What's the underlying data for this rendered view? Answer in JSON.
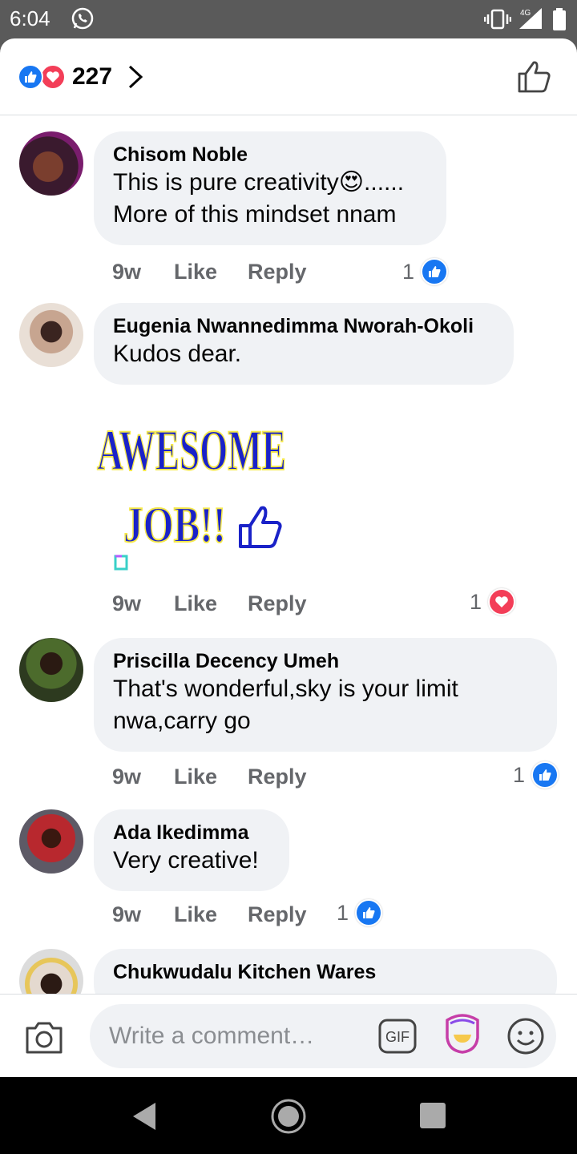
{
  "status_bar": {
    "time": "6:04",
    "network": "4G"
  },
  "header": {
    "reaction_count": "227"
  },
  "comments": [
    {
      "author": "Chisom Noble",
      "lines": [
        "This is pure creativity😍......",
        "More of this mindset nnam"
      ],
      "time": "9w",
      "like_label": "Like",
      "reply_label": "Reply",
      "reaction_count": "1",
      "reaction": "like"
    },
    {
      "author": "Eugenia Nwannedimma Nworah-Okoli",
      "lines": [
        "Kudos dear."
      ],
      "sticker_text": [
        "AWESOME",
        "JOB!!"
      ],
      "time": "9w",
      "like_label": "Like",
      "reply_label": "Reply",
      "reaction_count": "1",
      "reaction": "love"
    },
    {
      "author": "Priscilla Decency Umeh",
      "lines": [
        "That's wonderful,sky is your limit",
        "nwa,carry go"
      ],
      "time": "9w",
      "like_label": "Like",
      "reply_label": "Reply",
      "reaction_count": "1",
      "reaction": "like"
    },
    {
      "author": "Ada Ikedimma",
      "lines": [
        "Very creative!"
      ],
      "time": "9w",
      "like_label": "Like",
      "reply_label": "Reply",
      "reaction_count": "1",
      "reaction": "like"
    },
    {
      "author": "Chukwudalu Kitchen Wares"
    }
  ],
  "composer": {
    "placeholder": "Write a comment…",
    "gif_label": "GIF"
  },
  "colors": {
    "accent": "#1877f2",
    "love": "#f33e58",
    "bubble": "#f0f2f5",
    "meta": "#65676b"
  }
}
